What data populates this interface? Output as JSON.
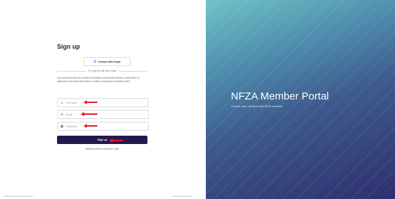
{
  "left": {
    "title": "Sign up",
    "google_button": "Continue with Google",
    "divider_text": "Or, sign up with your email",
    "password_hint": "Your password must be at least 8 characters and should include a combination of uppercase and lowercase letters, numbers and special characters (!$%)",
    "fields": [
      {
        "placeholder": "Full name",
        "icon": "user-icon"
      },
      {
        "placeholder": "Email",
        "icon": "mail-icon"
      },
      {
        "placeholder": "Password",
        "icon": "lock-icon"
      }
    ],
    "submit_label": "Sign up",
    "login_prompt": "Already have an account?",
    "login_link": "Login",
    "footer_left": "© National Fluid Power Association",
    "footer_right": "info@nfzamembers.org"
  },
  "right": {
    "title": "NFZA Member Portal",
    "subtitle": "Connect, learn, and grow with NFZA members."
  },
  "colors": {
    "primary": "#25194f",
    "arrow": "#e02020",
    "link": "#3a7bd5"
  }
}
